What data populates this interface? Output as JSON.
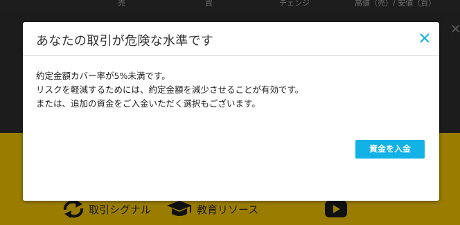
{
  "background": {
    "top_columns": [
      "売",
      "買",
      "チェンジ",
      "高値（売）/ 安値（買）"
    ],
    "bottom_nav": {
      "signals_label": "取引シグナル",
      "education_label": "教育リソース"
    }
  },
  "modal": {
    "title": "あなたの取引が危険な水準です",
    "lines": [
      "約定金額カバー率が5%未満です。",
      "リスクを軽減するためには、約定金額を減少させることが有効です。",
      "または、追加の資金をご入金いただく選択もございます。"
    ],
    "deposit_button": "資金を入金"
  },
  "colors": {
    "accent": "#12b1e6",
    "overlay_dark": "#1c1c1c",
    "background_yellow": "#9a7d00"
  },
  "icons": [
    "close-icon",
    "refresh-arrows-icon",
    "graduation-cap-icon",
    "youtube-play-icon"
  ]
}
